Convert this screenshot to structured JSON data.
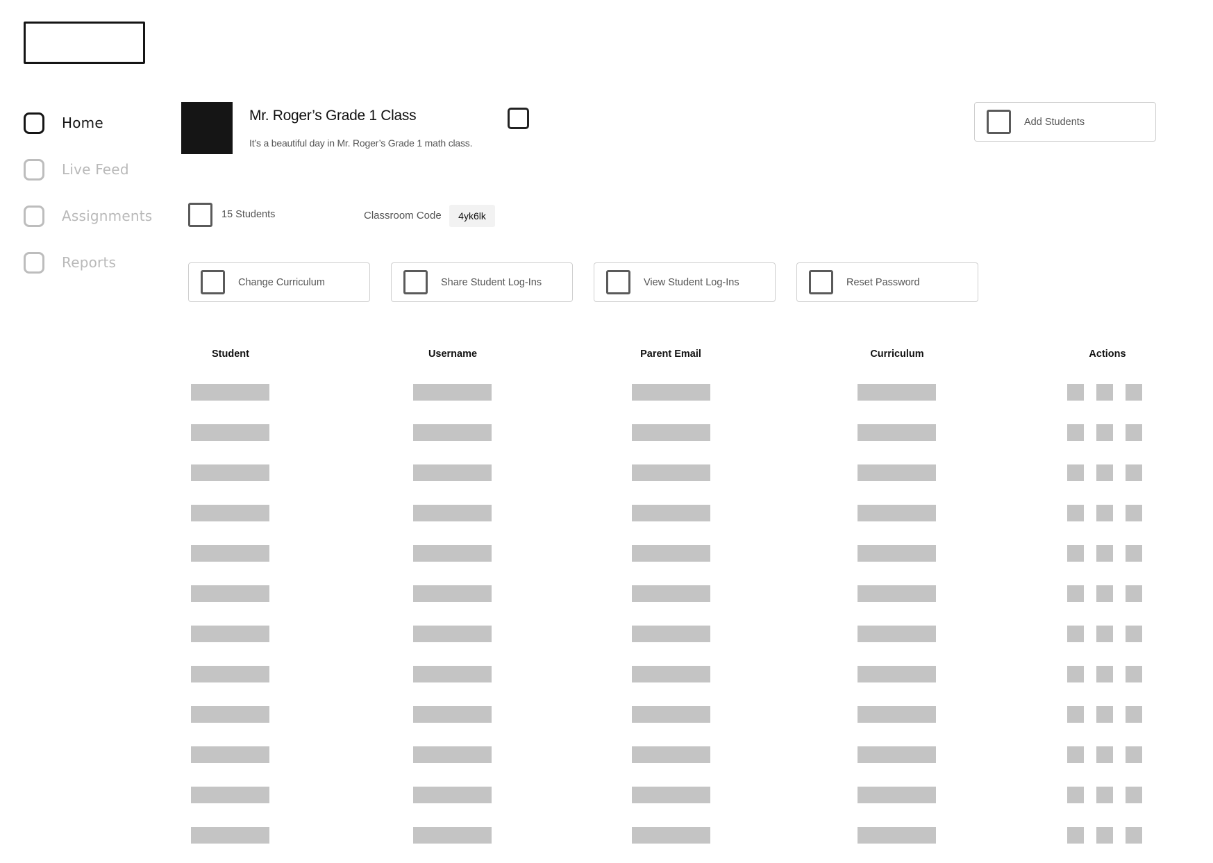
{
  "sidebar": {
    "items": [
      {
        "label": "Home",
        "icon": "home-icon",
        "active": true
      },
      {
        "label": "Live Feed",
        "icon": "live-feed-icon",
        "active": false
      },
      {
        "label": "Assignments",
        "icon": "assignments-icon",
        "active": false
      },
      {
        "label": "Reports",
        "icon": "reports-icon",
        "active": false
      }
    ]
  },
  "class_header": {
    "title": "Mr. Roger’s Grade 1 Class",
    "description": "It’s a beautiful day in Mr. Roger’s Grade 1 math class.",
    "add_students_label": "Add Students"
  },
  "class_info": {
    "students_count": "15 Students",
    "classroom_code_label": "Classroom Code",
    "classroom_code": "4yk6lk"
  },
  "actions": [
    {
      "label": "Change Curriculum"
    },
    {
      "label": "Share Student Log-Ins"
    },
    {
      "label": "View Student Log-Ins"
    },
    {
      "label": "Reset Password"
    }
  ],
  "table": {
    "columns": [
      "Student",
      "Username",
      "Parent Email",
      "Curriculum",
      "Actions"
    ],
    "row_count": 12,
    "row_actions_per_row": 3
  },
  "colors": {
    "active": "#151515",
    "inactive": "#bdbdbd",
    "placeholder": "#c4c4c4",
    "chip": "#f2f2f2"
  }
}
